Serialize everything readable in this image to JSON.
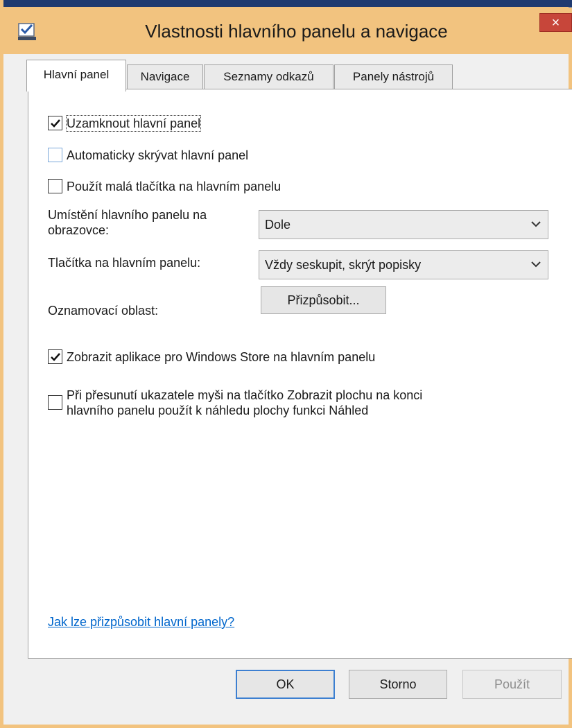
{
  "window": {
    "title": "Vlastnosti hlavního panelu a navigace",
    "close_label": "×"
  },
  "tabs": [
    {
      "label": "Hlavní panel",
      "active": true
    },
    {
      "label": "Navigace",
      "active": false
    },
    {
      "label": "Seznamy odkazů",
      "active": false
    },
    {
      "label": "Panely nástrojů",
      "active": false
    }
  ],
  "options": {
    "lock_taskbar": {
      "label": "Uzamknout hlavní panel",
      "checked": true
    },
    "auto_hide": {
      "label": "Automaticky skrývat hlavní panel",
      "checked": false
    },
    "small_buttons": {
      "label": "Použít malá tlačítka na hlavním panelu",
      "checked": false
    },
    "store_apps": {
      "label": "Zobrazit aplikace pro Windows Store na hlavním panelu",
      "checked": true
    },
    "peek": {
      "label_line1": "Při přesunutí ukazatele myši na tlačítko Zobrazit plochu na konci",
      "label_line2": "hlavního panelu použít k náhledu plochy funkci Náhled",
      "checked": false
    }
  },
  "location": {
    "label_line1": "Umístění hlavního panelu na",
    "label_line2": "obrazovce:",
    "value": "Dole"
  },
  "taskbar_buttons": {
    "label": "Tlačítka na hlavním panelu:",
    "value": "Vždy seskupit, skrýt popisky"
  },
  "notification_area": {
    "label": "Oznamovací oblast:",
    "button_label": "Přizpůsobit..."
  },
  "help_link": "Jak lze přizpůsobit hlavní panely?",
  "footer": {
    "ok_label": "OK",
    "cancel_label": "Storno",
    "apply_label": "Použít"
  }
}
